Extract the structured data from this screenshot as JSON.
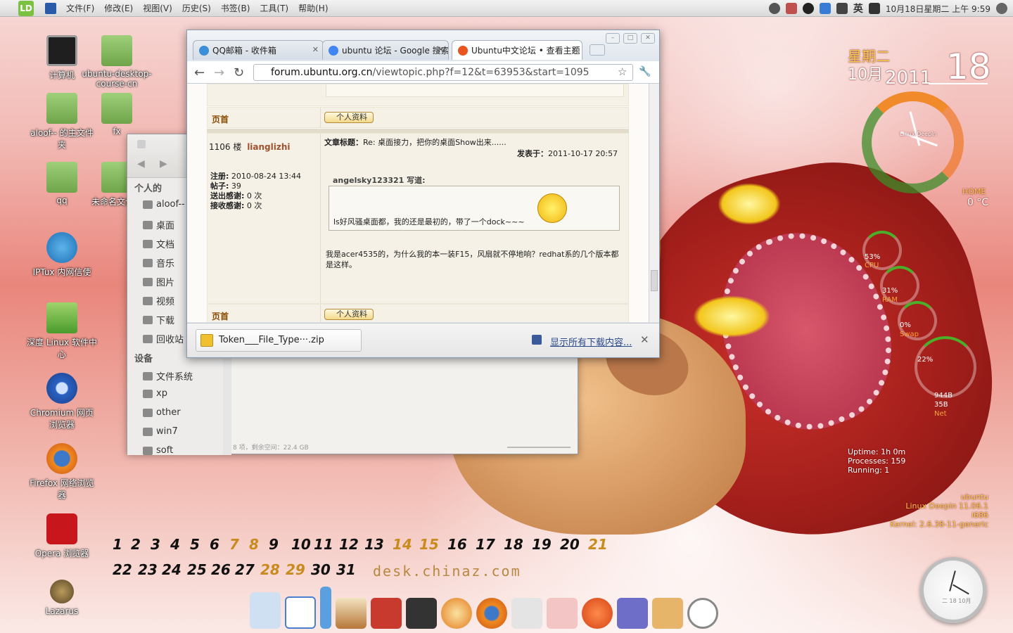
{
  "top_panel": {
    "logo_text": "LD",
    "menu": [
      "文件(F)",
      "修改(E)",
      "视图(V)",
      "历史(S)",
      "书签(B)",
      "工具(T)",
      "帮助(H)"
    ],
    "ime": "英",
    "clock": "10月18日星期二 上午 9:59"
  },
  "desktop_icons": [
    {
      "label": "计算机",
      "kind": "computer"
    },
    {
      "label": "ubuntu-desktop-course-cn",
      "kind": "folder"
    },
    {
      "label": "aloof-- 的主文件夹",
      "kind": "home"
    },
    {
      "label": "fx",
      "kind": "folder"
    },
    {
      "label": "qq",
      "kind": "folder"
    },
    {
      "label": "未命名文件夹",
      "kind": "folder"
    },
    {
      "label": "IPTux 内网信使",
      "kind": "app"
    },
    {
      "label": "深度 Linux 软件中心",
      "kind": "app"
    },
    {
      "label": "Chromium 网页浏览器",
      "kind": "app"
    },
    {
      "label": "Firefox 网络浏览器",
      "kind": "app"
    },
    {
      "label": "Opera 浏览器",
      "kind": "app"
    },
    {
      "label": "Lazarus",
      "kind": "app"
    }
  ],
  "conky": {
    "weekday": "星期二",
    "month": "10月",
    "year": "2011",
    "day": "18",
    "clock_label": "Linux Deepin",
    "home_label": "HOME",
    "temperature": "0 °C",
    "cpu": {
      "value": "53%",
      "label": "CPU"
    },
    "ram": {
      "value": "31%",
      "label": "RAM"
    },
    "swap": {
      "value": "0%",
      "label": "Swap"
    },
    "disk": {
      "value": "22%"
    },
    "net_up": "944B",
    "net_down": "35B",
    "net_label": "Net",
    "uptime": "Uptime: 1h 0m",
    "processes": "Processes: 159",
    "running": "Running: 1",
    "host": "ubuntu",
    "distro": "Linux Deepin 11.06.1  i686",
    "kernel": "Kernel: 2.6.38-11-generic",
    "analog_date": "二 18 10月"
  },
  "calendar": {
    "days": [
      "1",
      "2",
      "3",
      "4",
      "5",
      "6",
      "7",
      "8",
      "9",
      "10",
      "11",
      "12",
      "13",
      "14",
      "15",
      "16",
      "17",
      "18",
      "19",
      "20",
      "21",
      "22",
      "23",
      "24",
      "25",
      "26",
      "27",
      "28",
      "29",
      "30",
      "31"
    ],
    "site": "desk.chinaz.com"
  },
  "file_manager": {
    "personal_header": "个人的",
    "personal_items": [
      "aloof--",
      "桌面",
      "文档",
      "音乐",
      "图片",
      "视频",
      "下载",
      "回收站"
    ],
    "devices_header": "设备",
    "device_items": [
      "文件系统",
      "xp",
      "other",
      "win7",
      "soft"
    ],
    "status": "8 项，剩余空间：22.4 GB"
  },
  "browser": {
    "tabs": [
      {
        "title": "QQ邮箱 - 收件箱",
        "color": "#3a8fd8"
      },
      {
        "title": "ubuntu 论坛 - Google 搜索",
        "color": "#4285f4"
      },
      {
        "title": "Ubuntu中文论坛 • 查看主题",
        "color": "#e95420"
      }
    ],
    "url_host": "forum.ubuntu.org.cn",
    "url_path": "/viewtopic.php?f=12&t=63953&start=1095",
    "top_label": "页首",
    "profile_button": "个人资料",
    "post": {
      "floor": "1106 楼",
      "author": "lianglizhi",
      "subject_label": "文章标题：",
      "subject": "Re: 桌面接力，把你的桌面Show出来......",
      "posted_label": "发表于：",
      "posted": "2011-10-17 20:57",
      "reg_label": "注册:",
      "reg": "2010-08-24 13:44",
      "posts_label": "帖子:",
      "posts": "39",
      "thanks_out_label": "送出感谢:",
      "thanks_out": "0 次",
      "thanks_in_label": "接收感谢:",
      "thanks_in": "0 次",
      "quote_author": "angelsky123321 写道:",
      "quote_text": "ls好风骚桌面都，我的还是最初的，带了一个dock~~~",
      "body": "我是acer4535的，为什么我的本一装F15，风扇就不停地响？redhat系的几个版本都是这样。"
    },
    "download": {
      "file": "Token___File_Type···.zip",
      "show_all": "显示所有下载内容..."
    }
  },
  "colors": {
    "accent_gold": "#f6c84a",
    "ubuntu_orange": "#e95420"
  }
}
